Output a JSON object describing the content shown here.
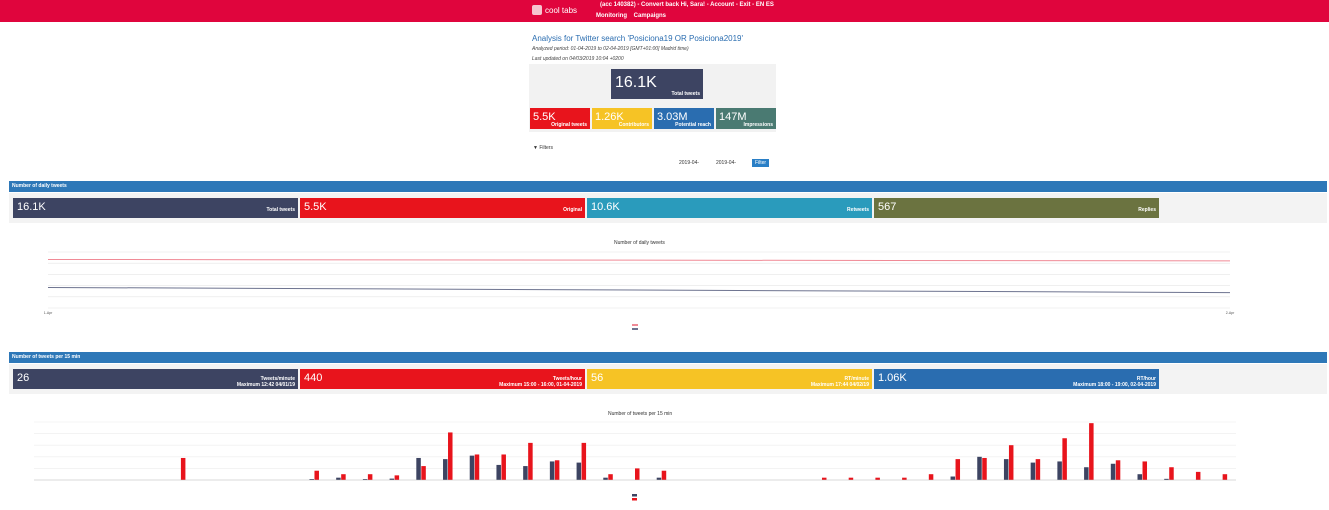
{
  "header": {
    "logo_text": "cool tabs",
    "account_line": "(acc 140382) - Convert back Hi, Sara! - Account - Exit - EN ES",
    "nav": [
      "Monitoring",
      "Campaigns"
    ]
  },
  "analysis": {
    "title": "Analysis for Twitter search 'Posiciona19 OR Posiciona2019'",
    "period": "Analyzed period: 01-04-2019 to 02-04-2019 [GMT+01:00] Madrid time)",
    "updated": "Last updated on 04/03/2019 10:04 +0200"
  },
  "kpi": {
    "total": {
      "value": "16.1K",
      "label": "Total tweets"
    },
    "tiles": [
      {
        "value": "5.5K",
        "label": "Original tweets",
        "color": "#e8141c"
      },
      {
        "value": "1.26K",
        "label": "Contributors",
        "color": "#f6c325"
      },
      {
        "value": "3.03M",
        "label": "Potential reach",
        "color": "#2a6db0"
      },
      {
        "value": "147M",
        "label": "Impressions",
        "color": "#4a7a72"
      }
    ]
  },
  "filters": {
    "label": "Filters",
    "date_from": "2019-04-",
    "date_to": "2019-04-",
    "button": "Filter"
  },
  "daily": {
    "section_title": "Number of daily tweets",
    "tiles": [
      {
        "value": "16.1K",
        "label": "Total tweets",
        "color": "#3d4462"
      },
      {
        "value": "5.5K",
        "label": "Original",
        "color": "#e8141c"
      },
      {
        "value": "10.6K",
        "label": "Retweets",
        "color": "#2a9bbc"
      },
      {
        "value": "567",
        "label": "Replies",
        "color": "#6b7340"
      }
    ],
    "chart_title": "Number of daily tweets"
  },
  "per15": {
    "section_title": "Number of tweets per 15 min",
    "tiles": [
      {
        "value": "26",
        "label": "Tweets/minute",
        "sub": "Maximum 12:42 04/01/19",
        "color": "#3d4462"
      },
      {
        "value": "440",
        "label": "Tweets/hour",
        "sub": "Maximum 15:00 - 16:00, 01-04-2019",
        "color": "#e8141c"
      },
      {
        "value": "56",
        "label": "RT/minute",
        "sub": "Maximum 17:44 04/02/19",
        "color": "#f6c325"
      },
      {
        "value": "1.06K",
        "label": "RT/hour",
        "sub": "Maximum 18:00 - 19:00, 02-04-2019",
        "color": "#2a6db0"
      }
    ],
    "chart_title": "Number of tweets per 15 min"
  },
  "chart_data": [
    {
      "type": "line",
      "title": "Number of daily tweets",
      "x": [
        "1-Apr",
        "2-Apr"
      ],
      "series": [
        {
          "values": [
            10400,
            10100
          ],
          "color": "#f08a96"
        },
        {
          "values": [
            4400,
            3300
          ],
          "color": "#6e7490"
        }
      ],
      "ylim": [
        0,
        12000
      ],
      "y_ticks": [
        "0",
        "2500",
        "5000",
        "7500",
        "10000"
      ]
    },
    {
      "type": "bar",
      "title": "Number of tweets per 15 min",
      "series": [
        {
          "color": "#3d4462",
          "values": [
            0,
            0,
            0,
            0,
            0,
            0,
            0,
            0,
            0,
            0,
            4,
            10,
            4,
            6,
            95,
            90,
            105,
            65,
            60,
            80,
            75,
            10,
            0,
            10,
            0,
            0,
            0,
            0,
            0,
            0,
            0,
            0,
            0,
            0,
            15,
            100,
            90,
            75,
            80,
            55,
            70,
            25,
            5,
            0,
            0
          ]
        },
        {
          "color": "#e8141c",
          "values": [
            0,
            0,
            0,
            0,
            0,
            95,
            0,
            0,
            0,
            0,
            40,
            25,
            25,
            20,
            60,
            205,
            110,
            110,
            160,
            85,
            160,
            25,
            50,
            40,
            0,
            0,
            0,
            0,
            0,
            10,
            10,
            10,
            10,
            25,
            90,
            95,
            150,
            90,
            180,
            245,
            85,
            80,
            55,
            35,
            25
          ]
        }
      ],
      "ylim": [
        0,
        250
      ]
    }
  ]
}
